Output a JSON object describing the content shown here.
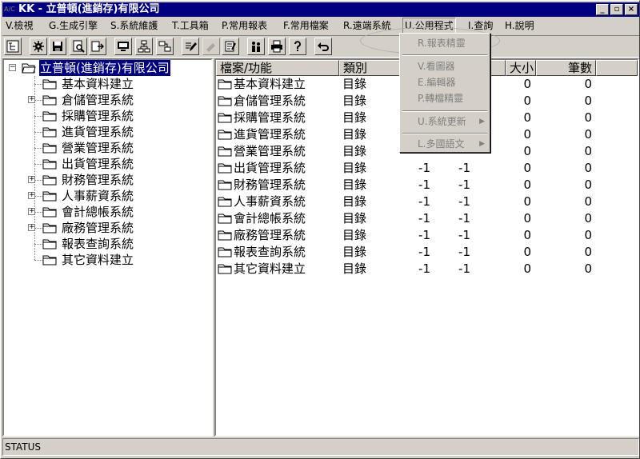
{
  "window": {
    "app_icon_text": "A/C",
    "title": "KK - 立普頓(進銷存)有限公司",
    "minimize_glyph": "_",
    "maximize_glyph": "▫",
    "close_glyph": "×"
  },
  "menubar": {
    "items": [
      {
        "label": "V.檢視"
      },
      {
        "label": "G.生成引擎"
      },
      {
        "label": "S.系統維護"
      },
      {
        "label": "T.工具箱"
      },
      {
        "label": "P.常用報表"
      },
      {
        "label": "F.常用檔案"
      },
      {
        "label": "R.遠端系統"
      },
      {
        "label": "U.公用程式"
      },
      {
        "label": "I.查詢"
      },
      {
        "label": "H.說明"
      }
    ]
  },
  "toolbar": {
    "icons": [
      "tree-view-icon",
      "settings-gear-icon",
      "save-icon",
      "print-preview-icon",
      "export-icon",
      "monitor-icon",
      "network-icon",
      "link-icon",
      "edit-icon",
      "tools-icon",
      "notepad-icon",
      "users-icon",
      "printer-icon",
      "help-icon",
      "undo-icon"
    ]
  },
  "tree": {
    "root": "立普頓(進銷存)有限公司",
    "items": [
      {
        "label": "基本資料建立",
        "expandable": false
      },
      {
        "label": "倉儲管理系統",
        "expandable": true
      },
      {
        "label": "採購管理系統",
        "expandable": false
      },
      {
        "label": "進貨管理系統",
        "expandable": false
      },
      {
        "label": "營業管理系統",
        "expandable": false
      },
      {
        "label": "出貨管理系統",
        "expandable": false
      },
      {
        "label": "財務管理系統",
        "expandable": true
      },
      {
        "label": "人事薪資系統",
        "expandable": true
      },
      {
        "label": "會計總帳系統",
        "expandable": true
      },
      {
        "label": "廠務管理系統",
        "expandable": true
      },
      {
        "label": "報表查詢系統",
        "expandable": false
      },
      {
        "label": "其它資料建立",
        "expandable": false
      }
    ],
    "expander_glyph": "+",
    "root_expander_glyph": "−"
  },
  "list": {
    "columns": [
      "檔案/功能",
      "類別",
      "大小",
      "筆數"
    ],
    "rows": [
      {
        "name": "基本資料建立",
        "type": "目錄",
        "a": "",
        "b": "",
        "size": "0",
        "count": "0"
      },
      {
        "name": "倉儲管理系統",
        "type": "目錄",
        "a": "",
        "b": "",
        "size": "0",
        "count": "0"
      },
      {
        "name": "採購管理系統",
        "type": "目錄",
        "a": "",
        "b": "",
        "size": "0",
        "count": "0"
      },
      {
        "name": "進貨管理系統",
        "type": "目錄",
        "a": "",
        "b": "",
        "size": "0",
        "count": "0"
      },
      {
        "name": "營業管理系統",
        "type": "目錄",
        "a": "",
        "b": "",
        "size": "0",
        "count": "0"
      },
      {
        "name": "出貨管理系統",
        "type": "目錄",
        "a": "-1",
        "b": "-1",
        "size": "0",
        "count": "0"
      },
      {
        "name": "財務管理系統",
        "type": "目錄",
        "a": "-1",
        "b": "-1",
        "size": "0",
        "count": "0"
      },
      {
        "name": "人事薪資系統",
        "type": "目錄",
        "a": "-1",
        "b": "-1",
        "size": "0",
        "count": "0"
      },
      {
        "name": "會計總帳系統",
        "type": "目錄",
        "a": "-1",
        "b": "-1",
        "size": "0",
        "count": "0"
      },
      {
        "name": "廠務管理系統",
        "type": "目錄",
        "a": "-1",
        "b": "-1",
        "size": "0",
        "count": "0"
      },
      {
        "name": "報表查詢系統",
        "type": "目錄",
        "a": "-1",
        "b": "-1",
        "size": "0",
        "count": "0"
      },
      {
        "name": "其它資料建立",
        "type": "目錄",
        "a": "-1",
        "b": "-1",
        "size": "0",
        "count": "0"
      }
    ]
  },
  "dropdown": {
    "items": [
      {
        "label": "R.報表精靈",
        "submenu": false
      },
      {
        "label": "V.看圖器",
        "submenu": false
      },
      {
        "label": "E.編輯器",
        "submenu": false
      },
      {
        "label": "P.轉檔精靈",
        "submenu": false
      },
      {
        "label": "U.系統更新",
        "submenu": true
      },
      {
        "label": "L.多國語文",
        "submenu": true
      }
    ],
    "submenu_glyph": "▶"
  },
  "status": {
    "text": "STATUS"
  }
}
